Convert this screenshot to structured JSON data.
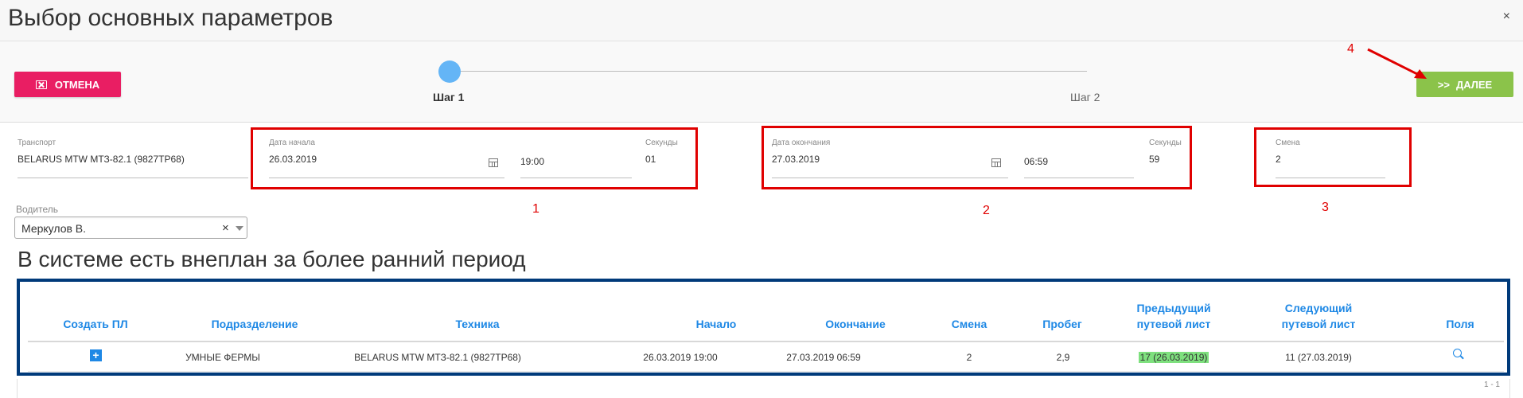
{
  "dialog": {
    "title": "Выбор основных параметров",
    "close": "×"
  },
  "toolbar": {
    "cancel_label": "ОТМЕНА",
    "next_label": "ДАЛЕЕ",
    "next_icon": ">>"
  },
  "stepper": {
    "step1": "Шаг 1",
    "step2": "Шаг 2",
    "active_step": 1
  },
  "form": {
    "transport": {
      "label": "Транспорт",
      "value": "BELARUS MTW МТЗ-82.1 (9827ТР68)"
    },
    "start_date": {
      "label": "Дата начала",
      "value": "26.03.2019",
      "time": "19:00"
    },
    "start_seconds": {
      "label": "Секунды",
      "value": "01"
    },
    "end_date": {
      "label": "Дата окончания",
      "value": "27.03.2019",
      "time": "06:59"
    },
    "end_seconds": {
      "label": "Секунды",
      "value": "59"
    },
    "shift": {
      "label": "Смена",
      "value": "2"
    },
    "driver": {
      "label": "Водитель",
      "value": "Меркулов В.",
      "clear": "×"
    }
  },
  "annotations": [
    "1",
    "2",
    "3",
    "4"
  ],
  "annotation_color": "#e00000",
  "section": {
    "title": "В системе есть внеплан за более ранний период"
  },
  "table": {
    "columns": [
      "Создать ПЛ",
      "Подразделение",
      "Техника",
      "Начало",
      "Окончание",
      "Смена",
      "Пробег",
      "Предыдущий путевой лист",
      "Следующий путевой лист",
      "Поля"
    ],
    "rows": [
      {
        "create": "+",
        "department": "УМНЫЕ ФЕРМЫ",
        "vehicle": "BELARUS MTW МТЗ-82.1 (9827ТР68)",
        "start": "26.03.2019 19:00",
        "end": "27.03.2019 06:59",
        "shift": "2",
        "mileage": "2,9",
        "prev_waybill": "17 (26.03.2019)",
        "next_waybill": "11 (27.03.2019)"
      }
    ],
    "pager": "1 - 1"
  },
  "colors": {
    "cancel": "#e91e63",
    "next": "#8bc34a",
    "step_active": "#64b5f6",
    "header_text": "#1e88e5",
    "table_frame": "#003a7a",
    "highlight": "#7ee07e"
  }
}
